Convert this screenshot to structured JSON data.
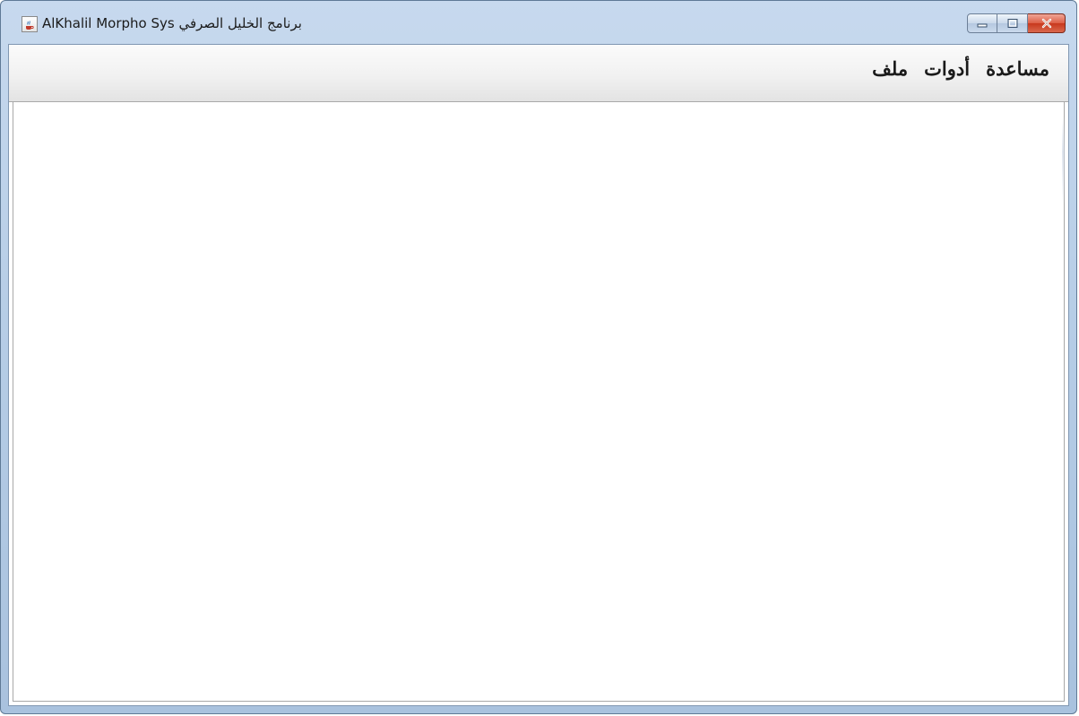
{
  "window": {
    "title": "برنامج الخليل الصرفي AlKhalil Morpho Sys",
    "app_icon": "java-coffee-cup-icon",
    "controls": {
      "minimize_icon": "minimize-icon",
      "maximize_icon": "maximize-icon",
      "close_icon": "close-icon"
    }
  },
  "menubar": {
    "items": [
      {
        "label": "ملف"
      },
      {
        "label": "أدوات"
      },
      {
        "label": "مساعدة"
      }
    ]
  },
  "colors": {
    "title_bar": "#b6cde6",
    "close_button": "#d04a30",
    "menu_bar": "#f1f1f1",
    "content_background": "#ffffff"
  }
}
